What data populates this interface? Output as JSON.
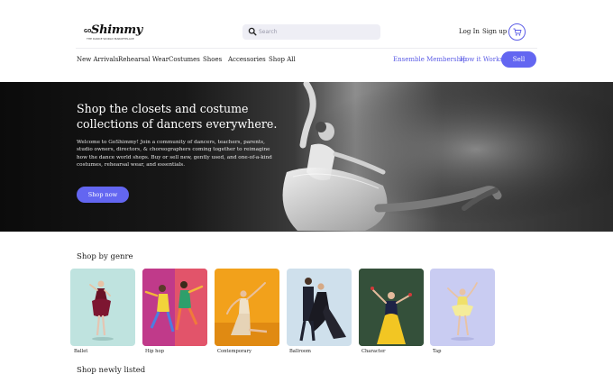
{
  "brand": {
    "prefix": "GO",
    "name": "Shimmy",
    "tagline": "THE DANCE WORLD MARKETPLACE"
  },
  "search": {
    "placeholder": "Search"
  },
  "header": {
    "login": "Log In",
    "signup": "Sign up"
  },
  "nav": {
    "items": [
      "New Arrivals",
      "Rehearsal Wear",
      "Costumes",
      "Shoes",
      "Accessories",
      "Shop All"
    ],
    "right": [
      "Ensemble Membership",
      "How it Works"
    ],
    "sell": "Sell"
  },
  "hero": {
    "title": "Shop the closets and costume collections of dancers everywhere.",
    "body": "Welcome to GoShimmy! Join a community of dancers, teachers, parents, studio owners, directors, & choreographers coming together to reimagine how the dance world shops. Buy or sell new, gently used, and one-of-a-kind costumes, rehearsal wear, and essentials.",
    "cta": "Shop now"
  },
  "genres": {
    "heading": "Shop by genre",
    "items": [
      {
        "label": "Ballet",
        "bg": "#bfe3df"
      },
      {
        "label": "Hip hop",
        "bg": "#d94b73"
      },
      {
        "label": "Contemporary",
        "bg": "#f2a11b"
      },
      {
        "label": "Ballroom",
        "bg": "#cfe0ec"
      },
      {
        "label": "Character",
        "bg": "#3d5e43"
      },
      {
        "label": "Tap",
        "bg": "#c9ccf2"
      }
    ]
  },
  "newly_listed": {
    "heading": "Shop newly listed"
  },
  "colors": {
    "accent": "#6366f1"
  }
}
